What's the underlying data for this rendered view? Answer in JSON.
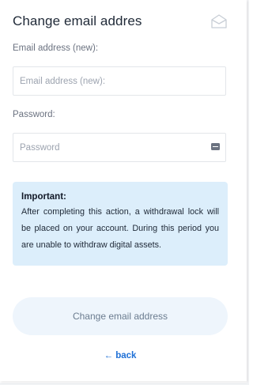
{
  "form": {
    "title": "Change email addres",
    "email_label": "Email address (new):",
    "email_placeholder": "Email address (new):",
    "email_value": "",
    "password_label": "Password:",
    "password_placeholder": "Password",
    "password_value": "",
    "submit_label": "Change email address",
    "back_label": "← back"
  },
  "notice": {
    "title": "Important:",
    "body": "After completing this action, a withdrawal lock will be placed on your account. During this period you are unable to withdraw digital assets."
  },
  "icons": {
    "header": "envelope-open-icon",
    "password_field": "password-manager-key-icon"
  },
  "colors": {
    "notice_bg": "#dceefb",
    "button_bg": "#eef5fc",
    "link": "#1d6fd6"
  }
}
